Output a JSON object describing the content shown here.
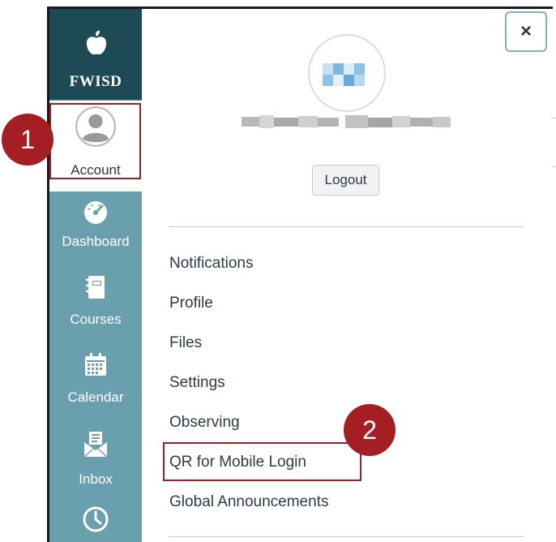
{
  "sidebar": {
    "brand": {
      "name": "FWISD",
      "icon": "apple-icon"
    },
    "items": [
      {
        "key": "account",
        "label": "Account",
        "icon": "user-avatar-icon",
        "active": true
      },
      {
        "key": "dashboard",
        "label": "Dashboard",
        "icon": "dashboard-gauge-icon"
      },
      {
        "key": "courses",
        "label": "Courses",
        "icon": "courses-book-icon"
      },
      {
        "key": "calendar",
        "label": "Calendar",
        "icon": "calendar-icon"
      },
      {
        "key": "inbox",
        "label": "Inbox",
        "icon": "inbox-icon"
      },
      {
        "key": "history",
        "label": "",
        "icon": "clock-icon"
      }
    ]
  },
  "tray": {
    "close_label": "×",
    "logout_label": "Logout",
    "links": [
      "Notifications",
      "Profile",
      "Files",
      "Settings",
      "Observing",
      "QR for Mobile Login",
      "Global Announcements"
    ]
  },
  "callouts": [
    {
      "number": "1",
      "target": "Account"
    },
    {
      "number": "2",
      "target": "QR for Mobile Login"
    }
  ],
  "colors": {
    "sidebar_bg": "#6aa0ae",
    "brand_bg": "#1e4a55",
    "callout": "#a41e23",
    "link_text": "#2d3b45"
  }
}
